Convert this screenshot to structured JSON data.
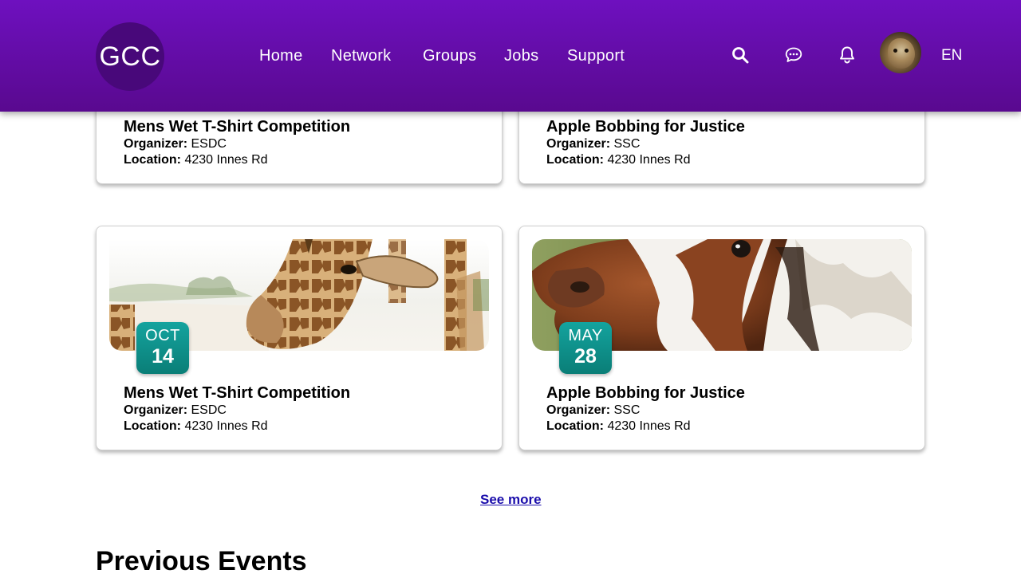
{
  "header": {
    "logo_text": "GCC",
    "nav": [
      "Home",
      "Network",
      "Groups",
      "Jobs",
      "Support"
    ],
    "icons": [
      "search-icon",
      "chat-icon",
      "bell-icon"
    ],
    "language": "EN",
    "colors": {
      "gradient_top": "#6e10bf",
      "gradient_bottom": "#59098f"
    }
  },
  "labels": {
    "organizer": "Organizer:",
    "location": "Location:"
  },
  "events_top": [
    {
      "title": "Mens Wet T-Shirt Competition",
      "organizer": "ESDC",
      "location": "4230 Innes Rd"
    },
    {
      "title": "Apple Bobbing for Justice",
      "organizer": "SSC",
      "location": "4230 Innes Rd"
    }
  ],
  "events": [
    {
      "month": "OCT",
      "day": "14",
      "title": "Mens Wet T-Shirt Competition",
      "organizer": "ESDC",
      "location": "4230 Innes Rd",
      "image": "giraffes"
    },
    {
      "month": "MAY",
      "day": "28",
      "title": "Apple Bobbing for Justice",
      "organizer": "SSC",
      "location": "4230 Innes Rd",
      "image": "horse"
    }
  ],
  "badge_color": "#0a8a84",
  "link_color": "#1a0dab",
  "see_more": "See more",
  "previous_events_title": "Previous Events"
}
